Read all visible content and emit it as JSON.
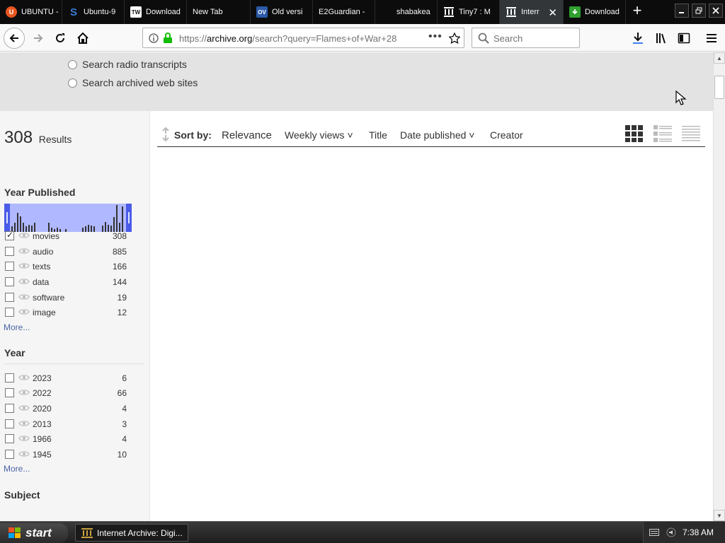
{
  "browser": {
    "tabs": [
      {
        "label": "UBUNTU -",
        "favicon_text": "U",
        "favicon_color": "#e8551e"
      },
      {
        "label": "Ubuntu-9",
        "favicon_text": "S",
        "favicon_color": "#1f5fbf"
      },
      {
        "label": "Download",
        "favicon_text": "TW",
        "favicon_color": "#111111"
      },
      {
        "label": "New Tab",
        "favicon_text": "",
        "favicon_color": "#0c0c0d"
      },
      {
        "label": "Old versi",
        "favicon_text": "OV",
        "favicon_color": "#2b5aa8"
      },
      {
        "label": "E2Guardian -",
        "favicon_text": "",
        "favicon_color": "#0c0c0d"
      },
      {
        "label": "shabakea",
        "favicon_text": "",
        "favicon_color": "#0c0c0d"
      },
      {
        "label": "Tiny7 : M",
        "favicon_text": "",
        "favicon_color": "#ffffff"
      },
      {
        "label": "Interr",
        "favicon_text": "",
        "favicon_color": "#ffffff"
      },
      {
        "label": "Download",
        "favicon_text": "",
        "favicon_color": "#30a030"
      }
    ],
    "url": {
      "prefix": "https://",
      "host": "archive.org",
      "path": "/search?query=Flames+of+War+28"
    },
    "search_placeholder": "Search"
  },
  "page": {
    "radio_options": [
      "Search radio transcripts",
      "Search archived web sites"
    ],
    "results": {
      "count": "308",
      "label": "Results"
    },
    "year_published_heading": "Year Published",
    "histogram_bars": [
      8,
      14,
      28,
      23,
      14,
      8,
      11,
      9,
      14,
      0,
      0,
      0,
      0,
      14,
      6,
      4,
      6,
      4,
      0,
      4,
      0,
      0,
      0,
      0,
      0,
      6,
      8,
      11,
      9,
      8,
      0,
      0,
      9,
      15,
      11,
      9,
      22,
      40,
      14,
      38
    ],
    "media_types": [
      {
        "name": "movies",
        "count": "308",
        "checked": true
      },
      {
        "name": "audio",
        "count": "885",
        "checked": false
      },
      {
        "name": "texts",
        "count": "166",
        "checked": false
      },
      {
        "name": "data",
        "count": "144",
        "checked": false
      },
      {
        "name": "software",
        "count": "19",
        "checked": false
      },
      {
        "name": "image",
        "count": "12",
        "checked": false
      }
    ],
    "more_label": "More...",
    "year_heading": "Year",
    "years": [
      {
        "name": "2023",
        "count": "6"
      },
      {
        "name": "2022",
        "count": "66"
      },
      {
        "name": "2020",
        "count": "4"
      },
      {
        "name": "2013",
        "count": "3"
      },
      {
        "name": "1966",
        "count": "4"
      },
      {
        "name": "1945",
        "count": "10"
      }
    ],
    "subject_heading": "Subject",
    "sort": {
      "label": "Sort by:",
      "options": [
        "Relevance",
        "Weekly views",
        "Title",
        "Date published",
        "Creator"
      ]
    }
  },
  "taskbar": {
    "start_label": "start",
    "task_label": "Internet Archive: Digi...",
    "clock": "7:38 AM"
  },
  "colors": {
    "tab_bg": "#0c0c0d",
    "histogram": "#b0b8ff",
    "link": "#4b64a8"
  }
}
